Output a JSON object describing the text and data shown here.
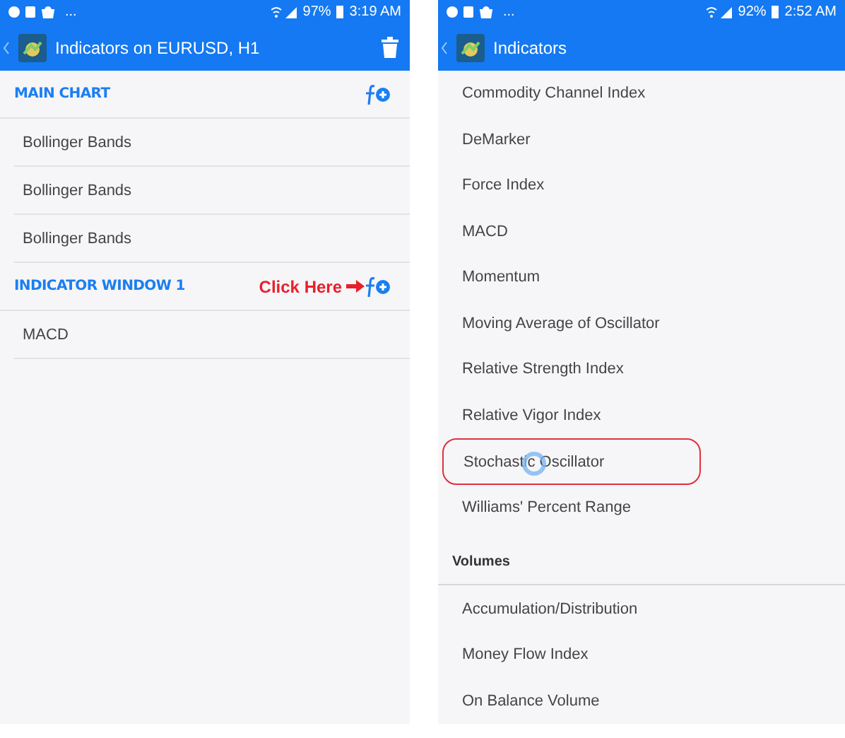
{
  "screens": [
    {
      "status_bar": {
        "more": "...",
        "battery": "97%",
        "time": "3:19 AM"
      },
      "app_bar": {
        "title": "Indicators on EURUSD, H1",
        "delete_button": true
      },
      "sections": [
        {
          "title": "MAIN CHART",
          "items": [
            "Bollinger Bands",
            "Bollinger Bands",
            "Bollinger Bands"
          ]
        },
        {
          "title": "INDICATOR WINDOW 1",
          "callout": "Click Here",
          "items": [
            "MACD"
          ]
        }
      ]
    },
    {
      "status_bar": {
        "more": "...",
        "battery": "92%",
        "time": "2:52 AM"
      },
      "app_bar": {
        "title": "Indicators"
      },
      "list": [
        {
          "kind": "item",
          "label": "Commodity Channel Index",
          "highlighted": false
        },
        {
          "kind": "item",
          "label": "DeMarker",
          "highlighted": false
        },
        {
          "kind": "item",
          "label": "Force Index",
          "highlighted": false
        },
        {
          "kind": "item",
          "label": "MACD",
          "highlighted": false
        },
        {
          "kind": "item",
          "label": "Momentum",
          "highlighted": false
        },
        {
          "kind": "item",
          "label": "Moving Average of Oscillator",
          "highlighted": false
        },
        {
          "kind": "item",
          "label": "Relative Strength Index",
          "highlighted": false
        },
        {
          "kind": "item",
          "label": "Relative Vigor Index",
          "highlighted": false
        },
        {
          "kind": "item",
          "label": "Stochastic Oscillator",
          "highlighted": true
        },
        {
          "kind": "item",
          "label": "Williams' Percent Range",
          "highlighted": false
        },
        {
          "kind": "header",
          "label": "Volumes"
        },
        {
          "kind": "item",
          "label": "Accumulation/Distribution",
          "highlighted": false
        },
        {
          "kind": "item",
          "label": "Money Flow Index",
          "highlighted": false
        },
        {
          "kind": "item",
          "label": "On Balance Volume",
          "highlighted": false
        }
      ]
    }
  ]
}
